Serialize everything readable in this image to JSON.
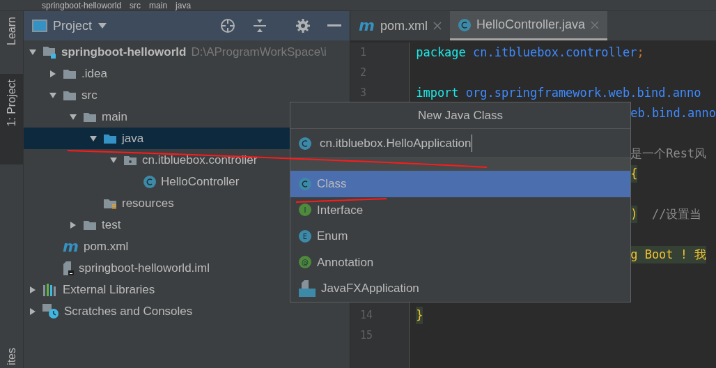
{
  "breadcrumbs": [
    "springboot-helloworld",
    "src",
    "main",
    "java"
  ],
  "tool_strip": [
    {
      "label": "Learn",
      "selected": false
    },
    {
      "label": "1: Project",
      "selected": true
    }
  ],
  "tool_strip_bottom": "ites",
  "project_panel": {
    "title": "Project"
  },
  "tree": [
    {
      "label": "springboot-helloworld",
      "path": "D:\\AProgramWorkSpace\\i",
      "kind": "module",
      "expanded": true,
      "selected": false,
      "children": [
        {
          "label": ".idea",
          "kind": "folder",
          "expanded": false,
          "selected": false
        },
        {
          "label": "src",
          "kind": "folder",
          "expanded": true,
          "selected": false,
          "children": [
            {
              "label": "main",
              "kind": "folder",
              "expanded": true,
              "selected": false,
              "children": [
                {
                  "label": "java",
                  "kind": "source",
                  "expanded": true,
                  "selected": true,
                  "children": [
                    {
                      "label": "cn.itbluebox.controller",
                      "kind": "package",
                      "expanded": true,
                      "selected": false,
                      "children": [
                        {
                          "label": "HelloController",
                          "kind": "class",
                          "selected": false
                        }
                      ]
                    }
                  ]
                },
                {
                  "label": "resources",
                  "kind": "resources",
                  "selected": false
                }
              ]
            },
            {
              "label": "test",
              "kind": "folder",
              "expanded": false,
              "selected": false
            }
          ]
        },
        {
          "label": "pom.xml",
          "kind": "maven",
          "icon_text": "m",
          "selected": false
        },
        {
          "label": "springboot-helloworld.iml",
          "kind": "iml",
          "selected": false
        }
      ]
    },
    {
      "label": "External Libraries",
      "kind": "libraries",
      "expanded": false,
      "selected": false
    },
    {
      "label": "Scratches and Consoles",
      "kind": "scratches",
      "expanded": false,
      "selected": false
    }
  ],
  "editor_tabs": [
    {
      "label": "pom.xml",
      "kind": "maven",
      "icon_text": "m",
      "selected": false
    },
    {
      "label": "HelloController.java",
      "kind": "class",
      "selected": true
    }
  ],
  "code_lines": [
    {
      "number": "1",
      "kind": "full",
      "tokens": [
        {
          "kind": "keyword",
          "text": "package "
        },
        {
          "kind": "ident",
          "text": "cn.itbluebox.controller"
        },
        {
          "kind": "punct",
          "text": ";"
        }
      ]
    },
    {
      "number": "2",
      "kind": "full"
    },
    {
      "number": "3",
      "kind": "full",
      "tokens": [
        {
          "kind": "keyword",
          "text": "import "
        },
        {
          "kind": "ident",
          "text": "org.springframework.web.bind.anno"
        }
      ]
    },
    {
      "kind": "partial",
      "tokens": [
        {
          "kind": "ident",
          "text": "eb.bind.anno"
        }
      ]
    },
    {
      "kind": "partial"
    },
    {
      "kind": "partial",
      "tokens": [
        {
          "kind": "comment",
          "text": "是一个Rest风"
        }
      ]
    },
    {
      "kind": "partial",
      "tokens": [
        {
          "kind": "brace",
          "text": "{"
        }
      ]
    },
    {
      "kind": "partial"
    },
    {
      "kind": "partial",
      "tokens": [
        {
          "kind": "brace",
          "text": ")"
        },
        {
          "kind": "comment",
          "text": "  //设置当"
        }
      ]
    },
    {
      "kind": "partial"
    },
    {
      "kind": "partial",
      "tokens": [
        {
          "kind": "string",
          "text": "g Boot ! 我"
        }
      ]
    },
    {
      "kind": "partial"
    },
    {
      "kind": "partial"
    },
    {
      "number": "14",
      "kind": "full",
      "tokens": [
        {
          "kind": "brace",
          "text": "}"
        }
      ]
    },
    {
      "number": "15",
      "kind": "full"
    }
  ],
  "dialog": {
    "title": "New Java Class",
    "value": "cn.itbluebox.HelloApplication",
    "options": [
      {
        "label": "Class",
        "kind": "class",
        "selected": true
      },
      {
        "label": "Interface",
        "kind": "interface",
        "icon_text": "I",
        "selected": false
      },
      {
        "label": "Enum",
        "kind": "enum",
        "icon_text": "E",
        "selected": false
      },
      {
        "label": "Annotation",
        "kind": "annotation",
        "icon_text": "@",
        "selected": false
      },
      {
        "label": "JavaFXApplication",
        "kind": "javafx",
        "selected": false
      }
    ]
  }
}
